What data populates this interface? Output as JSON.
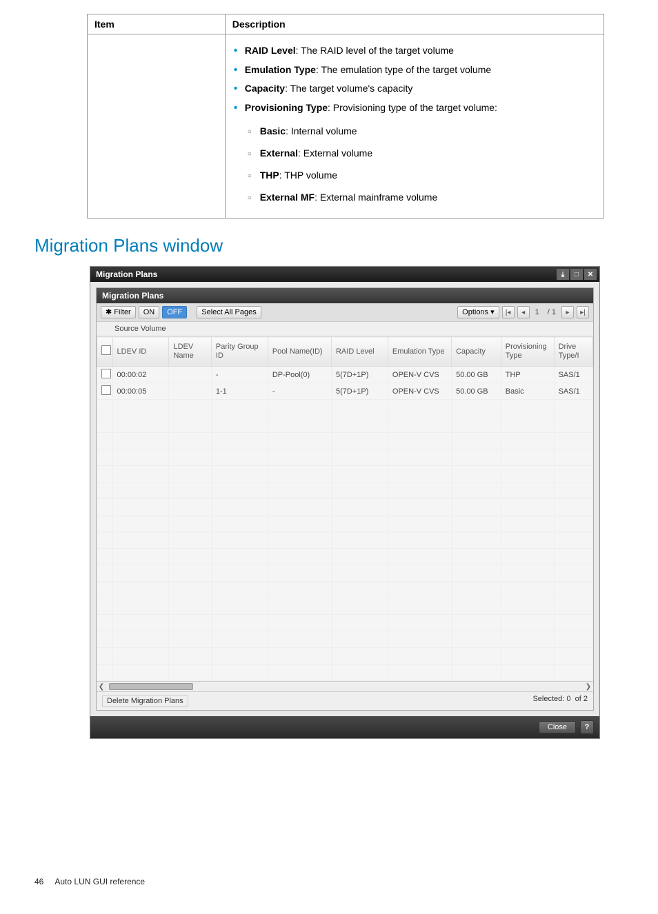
{
  "doc_table": {
    "head_item": "Item",
    "head_desc": "Description",
    "bullets": [
      {
        "b": "RAID Level",
        "t": ": The RAID level of the target volume"
      },
      {
        "b": "Emulation Type",
        "t": ": The emulation type of the target volume"
      },
      {
        "b": "Capacity",
        "t": ": The target volume's capacity"
      },
      {
        "b": "Provisioning Type",
        "t": ": Provisioning type of the target volume:"
      }
    ],
    "sub_bullets": [
      {
        "b": "Basic",
        "t": ": Internal volume"
      },
      {
        "b": "External",
        "t": ": External volume"
      },
      {
        "b": "THP",
        "t": ": THP volume"
      },
      {
        "b": "External MF",
        "t": ": External mainframe volume"
      }
    ]
  },
  "section_title": "Migration Plans window",
  "modal": {
    "title": "Migration Plans",
    "panel_title": "Migration Plans",
    "filter_label": "Filter",
    "on_label": "ON",
    "off_label": "OFF",
    "select_all_label": "Select All Pages",
    "options_label": "Options ▾",
    "page_current": "1",
    "page_total": "/ 1",
    "subheader": "Source Volume",
    "columns": [
      "LDEV ID",
      "LDEV Name",
      "Parity Group ID",
      "Pool Name(ID)",
      "RAID Level",
      "Emulation Type",
      "Capacity",
      "Provisioning Type",
      "Drive Type/I"
    ],
    "rows": [
      {
        "ldev_id": "00:00:02",
        "ldev_name": "",
        "pg": "-",
        "pool": "DP-Pool(0)",
        "raid": "5(7D+1P)",
        "emu": "OPEN-V CVS",
        "cap": "50.00 GB",
        "prov": "THP",
        "drv": "SAS/1"
      },
      {
        "ldev_id": "00:00:05",
        "ldev_name": "",
        "pg": "1-1",
        "pool": "-",
        "raid": "5(7D+1P)",
        "emu": "OPEN-V CVS",
        "cap": "50.00 GB",
        "prov": "Basic",
        "drv": "SAS/1"
      }
    ],
    "blank_rows": 17,
    "delete_label": "Delete Migration Plans",
    "selected_label": "Selected:",
    "selected_count": "0",
    "of_label": "of",
    "total_count": "2",
    "close_label": "Close",
    "help_label": "?"
  },
  "footer": {
    "page_no": "46",
    "title": "Auto LUN GUI reference"
  }
}
